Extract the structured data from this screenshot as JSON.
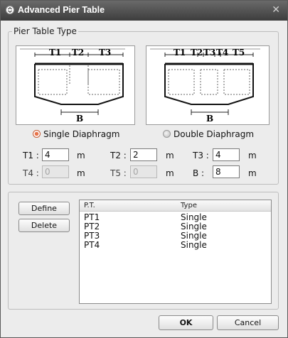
{
  "window": {
    "title": "Advanced Pier Table",
    "close_glyph": "✕"
  },
  "pier_table_type": {
    "title": "Pier Table Type",
    "single_diagram": {
      "labels": [
        "T1",
        "T2",
        "T3"
      ],
      "bottom_label": "B"
    },
    "double_diagram": {
      "labels": [
        "T1",
        "T2",
        "T3",
        "T4",
        "T5"
      ],
      "bottom_label": "B"
    },
    "single_radio": {
      "label": "Single Diaphragm",
      "checked": true
    },
    "double_radio": {
      "label": "Double Diaphragm",
      "checked": false
    }
  },
  "fields": {
    "t1": {
      "label": "T1 :",
      "value": "4",
      "unit": "m"
    },
    "t2": {
      "label": "T2 :",
      "value": "2",
      "unit": "m"
    },
    "t3": {
      "label": "T3 :",
      "value": "4",
      "unit": "m"
    },
    "t4": {
      "label": "T4 :",
      "value": "0",
      "unit": "m"
    },
    "t5": {
      "label": "T5 :",
      "value": "0",
      "unit": "m"
    },
    "b": {
      "label": "B :",
      "value": "8",
      "unit": "m"
    }
  },
  "buttons": {
    "define": "Define",
    "delete": "Delete",
    "ok": "OK",
    "cancel": "Cancel"
  },
  "table": {
    "headers": [
      "P.T.",
      "Type"
    ],
    "rows": [
      [
        "PT1",
        "Single"
      ],
      [
        "PT2",
        "Single"
      ],
      [
        "PT3",
        "Single"
      ],
      [
        "PT4",
        "Single"
      ]
    ]
  },
  "colors": {
    "radio_checked": "#e8734a",
    "title_bar": "#4a4a4a"
  }
}
